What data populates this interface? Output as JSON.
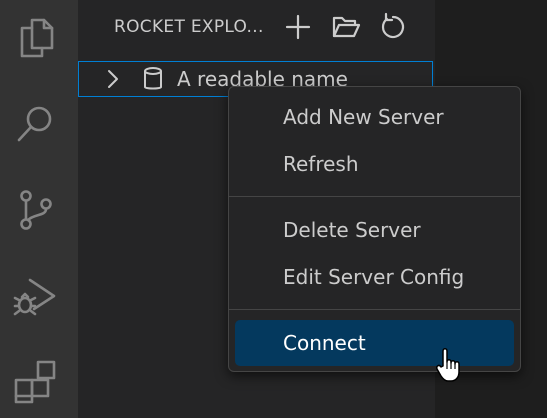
{
  "activity_bar": {
    "icons": [
      "explorer-icon",
      "search-icon",
      "source-control-icon",
      "run-debug-icon",
      "extensions-icon"
    ]
  },
  "sidebar": {
    "title": "ROCKET EXPLO...",
    "actions": [
      "add-icon",
      "open-folder-icon",
      "refresh-icon"
    ],
    "tree": {
      "items": [
        {
          "label": "A readable name",
          "icon": "database-icon",
          "expanded": false
        }
      ]
    }
  },
  "context_menu": {
    "groups": [
      [
        "Add New Server",
        "Refresh"
      ],
      [
        "Delete Server",
        "Edit Server Config"
      ],
      [
        "Connect"
      ]
    ],
    "active_item": "Connect"
  },
  "colors": {
    "activity_bar_bg": "#333333",
    "sidebar_bg": "#252526",
    "focus_border": "#007fd4",
    "menu_active_bg": "#04395e"
  }
}
